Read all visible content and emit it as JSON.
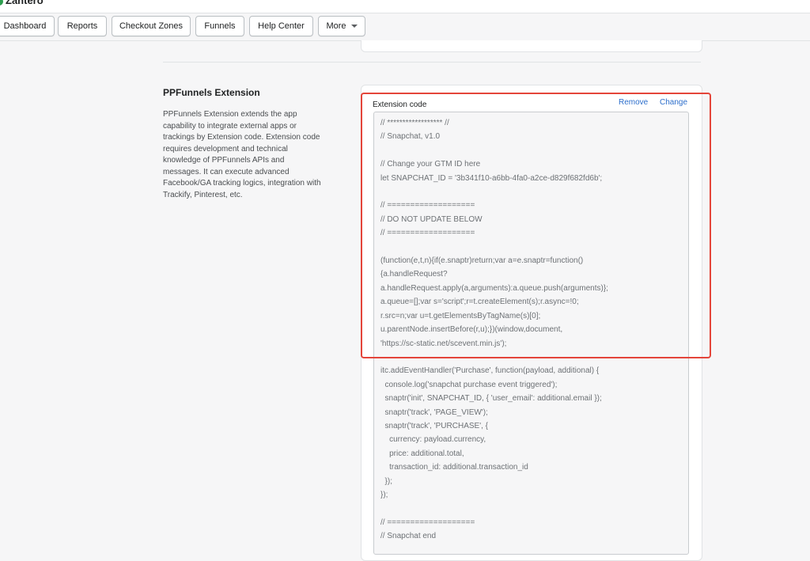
{
  "brand": {
    "name": "Zantero"
  },
  "nav": {
    "items": [
      {
        "label": "Dashboard"
      },
      {
        "label": "Reports"
      },
      {
        "label": "Checkout Zones"
      },
      {
        "label": "Funnels"
      },
      {
        "label": "Help Center"
      },
      {
        "label": "More"
      }
    ]
  },
  "section": {
    "title": "PPFunnels Extension",
    "description": "PPFunnels Extension extends the app capability to integrate external apps or trackings by Extension code. Extension code requires development and technical knowledge of PPFunnels APIs and messages. It can execute advanced Facebook/GA tracking logics, integration with Trackify, Pinterest, etc."
  },
  "extension": {
    "label": "Extension code",
    "remove_label": "Remove",
    "change_label": "Change",
    "code": "// ****************** //\n// Snapchat, v1.0\n\n// Change your GTM ID here\nlet SNAPCHAT_ID = '3b341f10-a6bb-4fa0-a2ce-d829f682fd6b';\n\n// ===================\n// DO NOT UPDATE BELOW\n// ===================\n\n(function(e,t,n){if(e.snaptr)return;var a=e.snaptr=function()\n{a.handleRequest?\na.handleRequest.apply(a,arguments):a.queue.push(arguments)};\na.queue=[];var s='script';r=t.createElement(s);r.async=!0;\nr.src=n;var u=t.getElementsByTagName(s)[0];\nu.parentNode.insertBefore(r,u);})(window,document,\n'https://sc-static.net/scevent.min.js');\n\nitc.addEventHandler('Purchase', function(payload, additional) {\n  console.log('snapchat purchase event triggered');\n  snaptr('init', SNAPCHAT_ID, { 'user_email': additional.email });\n  snaptr('track', 'PAGE_VIEW');\n  snaptr('track', 'PURCHASE', {\n    currency: payload.currency,\n    price: additional.total,\n    transaction_id: additional.transaction_id\n  });\n});\n\n// ===================\n// Snapchat end"
  },
  "colors": {
    "highlight": "#e4453a",
    "link": "#2c6ecb",
    "background": "#f6f6f7"
  }
}
